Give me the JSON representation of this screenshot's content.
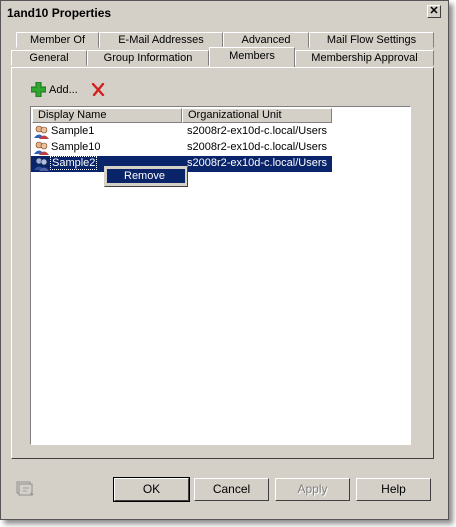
{
  "window": {
    "title": "1and10 Properties",
    "close_glyph": "✕"
  },
  "tabs_row1": [
    {
      "label": "Member Of"
    },
    {
      "label": "E-Mail Addresses"
    },
    {
      "label": "Advanced"
    },
    {
      "label": "Mail Flow Settings"
    }
  ],
  "tabs_row2": [
    {
      "label": "General"
    },
    {
      "label": "Group Information"
    },
    {
      "label": "Members",
      "active": true
    },
    {
      "label": "Membership Approval"
    }
  ],
  "toolbar": {
    "add_label": "Add...",
    "add_icon": "plus-icon",
    "remove_icon": "red-x-icon"
  },
  "members": {
    "columns": [
      "Display Name",
      "Organizational Unit"
    ],
    "rows": [
      {
        "name": "Sample1",
        "ou": "s2008r2-ex10d-c.local/Users"
      },
      {
        "name": "Sample10",
        "ou": "s2008r2-ex10d-c.local/Users"
      },
      {
        "name": "Sample2",
        "ou": "s2008r2-ex10d-c.local/Users",
        "selected": true
      }
    ]
  },
  "context_menu": {
    "items": [
      "Remove"
    ]
  },
  "buttons": {
    "ok": "OK",
    "cancel": "Cancel",
    "apply": "Apply",
    "help": "Help"
  },
  "colors": {
    "face": "#d4d0c8",
    "selection": "#0a246a",
    "plus": "#2fa82f",
    "remove": "#d42020"
  }
}
